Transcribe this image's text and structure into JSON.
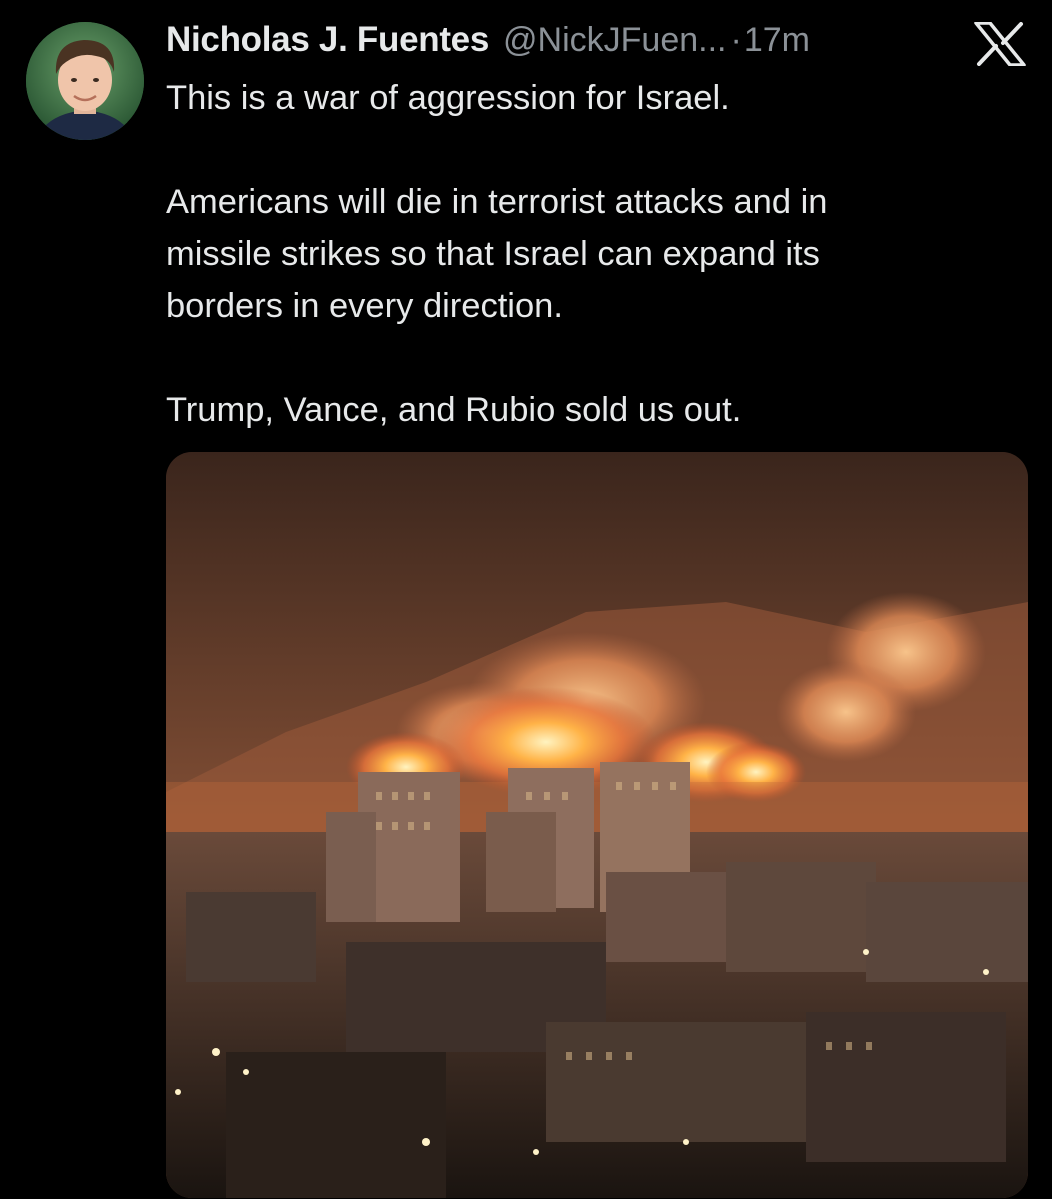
{
  "tweet": {
    "author": {
      "display_name": "Nicholas J. Fuentes",
      "handle": "@NickJFuen...",
      "avatar_icon": "profile-photo"
    },
    "separator": "·",
    "timestamp": "17m",
    "platform_logo": "x-logo-icon",
    "text_lines": [
      "This is a war of aggression for Israel.",
      "",
      "Americans will die in terrorist attacks and in",
      "missile strikes so that Israel can expand its",
      "borders in every direction.",
      "",
      "Trump, Vance, and Rubio sold us out."
    ],
    "media": {
      "kind": "photo",
      "subject": "night-city-explosions"
    }
  },
  "colors": {
    "background": "#000000",
    "text_primary": "#e7e9ea",
    "text_secondary": "#8b9197"
  }
}
